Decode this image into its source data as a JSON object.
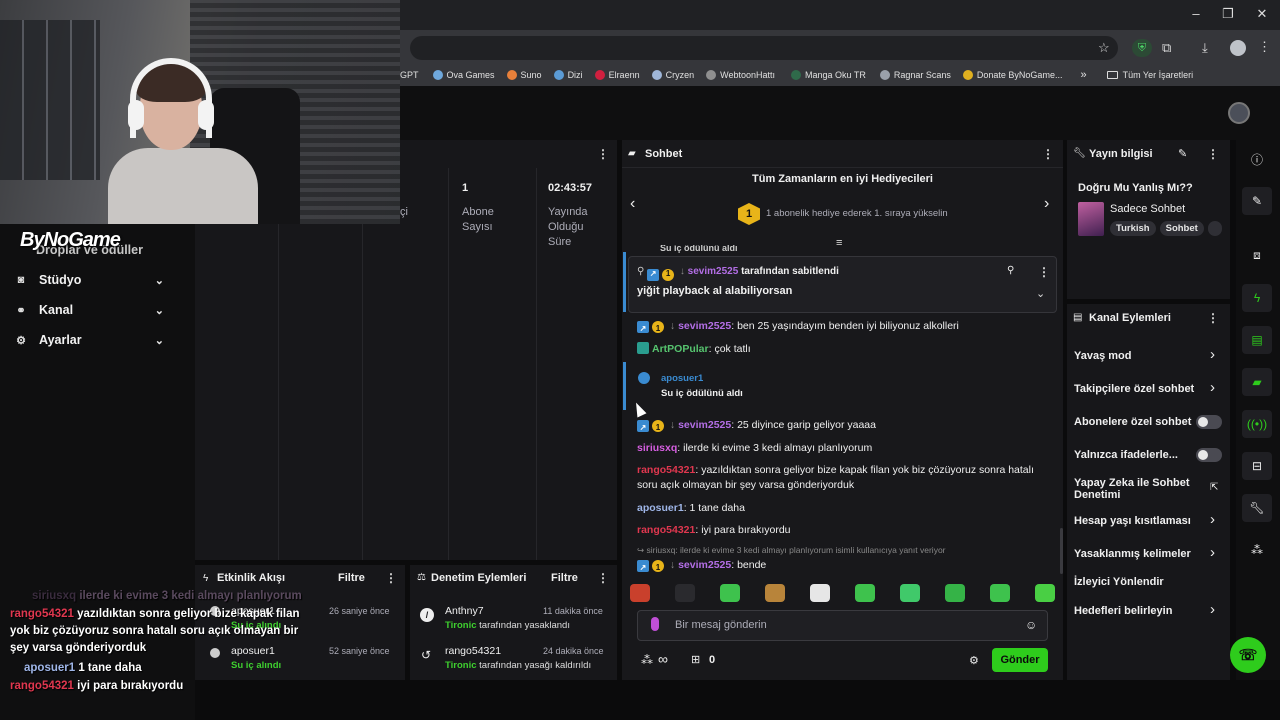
{
  "browser": {
    "bookmarks": [
      {
        "label": "GPT",
        "color": "#7a7a7a"
      },
      {
        "label": "Ova Games",
        "color": "#6fa8dc"
      },
      {
        "label": "Suno",
        "color": "#e8803a"
      },
      {
        "label": "Dizi",
        "color": "#5b9bd5"
      },
      {
        "label": "Elraenn",
        "color": "#d0203f"
      },
      {
        "label": "Cryzen",
        "color": "#9fb6d8"
      },
      {
        "label": "WebtoonHattı",
        "color": "#8f8f8f"
      },
      {
        "label": "Manga Oku TR",
        "color": "#2f6a4a"
      },
      {
        "label": "Ragnar Scans",
        "color": "#9aa0aa"
      },
      {
        "label": "Donate ByNoGame...",
        "color": "#e0b020"
      }
    ],
    "all_bookmarks": "Tüm Yer İşaretleri",
    "more": "»"
  },
  "overlay_logo": "ByNoGame",
  "sidebar": {
    "partial_item": "Droplar ve ödüller",
    "items": [
      {
        "label": "Stüdyo",
        "icon": "studio-icon"
      },
      {
        "label": "Kanal",
        "icon": "channel-icon"
      },
      {
        "label": "Ayarlar",
        "icon": "settings-icon"
      }
    ]
  },
  "stats": {
    "partial_label": "çi",
    "subs_value": "1",
    "subs_label_1": "Abone",
    "subs_label_2": "Sayısı",
    "uptime_value": "02:43:57",
    "uptime_label_1": "Yayında",
    "uptime_label_2": "Olduğu",
    "uptime_label_3": "Süre"
  },
  "activity": {
    "title": "Etkinlik Akışı",
    "filter": "Filtre",
    "items": [
      {
        "user": "aposuer1",
        "action": "Su iç alındı",
        "time": "26 saniye önce"
      },
      {
        "user": "aposuer1",
        "action": "Su iç alındı",
        "time": "52 saniye önce"
      }
    ]
  },
  "moderation": {
    "title": "Denetim Eylemleri",
    "filter": "Filtre",
    "items": [
      {
        "user": "Anthny7",
        "mod": "Tironic",
        "action": "tarafından yasaklandı",
        "time": "11 dakika önce"
      },
      {
        "user": "rango54321",
        "mod": "Tironic",
        "action": "tarafından yasağı kaldırıldı",
        "time": "24 dakika önce"
      }
    ]
  },
  "chat": {
    "title": "Sohbet",
    "leaderboard_title": "Tüm Zamanların en iyi Hediyecileri",
    "leaderboard_rank": "1",
    "leaderboard_text": "1 abonelik hediye ederek 1. sıraya yükselin",
    "cut_off_line": "Su iç ödülünü aldı",
    "pinned_by_user": "sevim2525",
    "pinned_by_text": "tarafından sabitlendi",
    "pinned_message": "yiğit playback al alabiliyorsan",
    "messages": [
      {
        "user": "sevim2525",
        "text": ": ben 25 yaşındayım benden iyi biliyonuz alkolleri",
        "color": "#b36ee6"
      },
      {
        "user": "ArtPOPular",
        "text": ": çok tatlı",
        "color": "#56c46f"
      },
      {
        "user": "sevim2525",
        "text": ": 25 diyince garip geliyor yaaaa",
        "color": "#b36ee6"
      },
      {
        "user": "siriusxq",
        "text": ": ilerde ki evime 3 kedi almayı planlıyorum",
        "color": "#d55ee0"
      },
      {
        "user": "rango54321",
        "text": ": yazıldıktan sonra geliyor bize kapak filan yok biz çözüyoruz sonra hatalı soru açık olmayan bir şey varsa gönderiyorduk",
        "color": "#e0374f"
      },
      {
        "user": "aposuer1",
        "text": ": 1 tane daha",
        "color": "#9fb6e8"
      },
      {
        "user": "rango54321",
        "text": ": iyi para bırakıyordu",
        "color": "#e0374f"
      },
      {
        "user": "sevim2525",
        "text": ": bende",
        "color": "#b36ee6"
      }
    ],
    "reward_user": "aposuer1",
    "reward_text": "Su iç ödülünü aldı",
    "reply_hint": "siriusxq: ilerde ki evime 3 kedi almayı planlıyorum isimli kullanıcıya yanıt veriyor",
    "input_placeholder": "Bir mesaj gönderin",
    "points": "∞",
    "gift_count": "0",
    "send_label": "Gönder"
  },
  "stream_info": {
    "title": "Yayın bilgisi",
    "stream_title": "Doğru Mu Yanlış Mı??",
    "category": "Sadece Sohbet",
    "tags": [
      "Turkish",
      "Sohbet"
    ]
  },
  "channel_actions": {
    "title": "Kanal Eylemleri",
    "items": [
      {
        "label": "Yavaş mod",
        "control": "chevron"
      },
      {
        "label": "Takipçilere özel sohbet",
        "control": "chevron"
      },
      {
        "label": "Abonelere özel sohbet",
        "control": "toggle"
      },
      {
        "label": "Yalnızca ifadelerle...",
        "control": "toggle"
      },
      {
        "label": "Yapay Zeka ile Sohbet Denetimi",
        "control": "external"
      },
      {
        "label": "Hesap yaşı kısıtlaması",
        "control": "chevron"
      },
      {
        "label": "Yasaklanmış kelimeler",
        "control": "chevron"
      },
      {
        "label": "İzleyici Yönlendir",
        "control": "none"
      },
      {
        "label": "Hedefleri belirleyin",
        "control": "chevron"
      }
    ]
  },
  "overlay_chat": [
    {
      "user": "siriusxq",
      "text": "ilerde ki evime 3 kedi almayı planlıyorum",
      "color": "#4a3a4e"
    },
    {
      "user": "rango54321",
      "text": "yazıldıktan sonra geliyor bize kapak filan yok biz çözüyoruz sonra hatalı soru açık olmayan bir şey varsa gönderiyorduk",
      "color": "#e0374f"
    },
    {
      "user": "aposuer1",
      "text": "1 tane daha",
      "color": "#9fb6e8"
    },
    {
      "user": "rango54321",
      "text": "iyi para bırakıyordu",
      "color": "#e0374f"
    }
  ],
  "colors": {
    "accent": "#2ecc1c",
    "panel": "#17171a",
    "background": "#0b0b0c"
  }
}
